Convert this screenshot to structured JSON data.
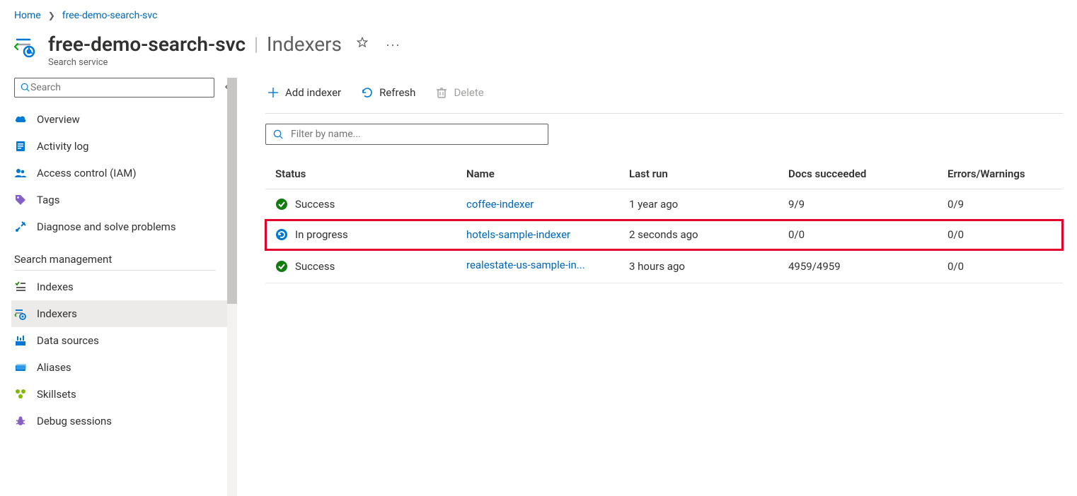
{
  "breadcrumb": {
    "home": "Home",
    "current": "free-demo-search-svc"
  },
  "header": {
    "resource_name": "free-demo-search-svc",
    "section": "Indexers",
    "subtitle": "Search service"
  },
  "sidebar": {
    "search_placeholder": "Search",
    "items": [
      {
        "label": "Overview"
      },
      {
        "label": "Activity log"
      },
      {
        "label": "Access control (IAM)"
      },
      {
        "label": "Tags"
      },
      {
        "label": "Diagnose and solve problems"
      }
    ],
    "section_title": "Search management",
    "mgmt_items": [
      {
        "label": "Indexes"
      },
      {
        "label": "Indexers"
      },
      {
        "label": "Data sources"
      },
      {
        "label": "Aliases"
      },
      {
        "label": "Skillsets"
      },
      {
        "label": "Debug sessions"
      }
    ]
  },
  "toolbar": {
    "add": "Add indexer",
    "refresh": "Refresh",
    "delete": "Delete"
  },
  "filter": {
    "placeholder": "Filter by name..."
  },
  "table": {
    "columns": {
      "status": "Status",
      "name": "Name",
      "last_run": "Last run",
      "docs": "Docs succeeded",
      "errors": "Errors/Warnings"
    },
    "rows": [
      {
        "status": "Success",
        "status_kind": "success",
        "name": "coffee-indexer",
        "last_run": "1 year ago",
        "docs": "9/9",
        "errors": "0/9"
      },
      {
        "status": "In progress",
        "status_kind": "progress",
        "name": "hotels-sample-indexer",
        "last_run": "2 seconds ago",
        "docs": "0/0",
        "errors": "0/0"
      },
      {
        "status": "Success",
        "status_kind": "success",
        "name": "realestate-us-sample-in...",
        "last_run": "3 hours ago",
        "docs": "4959/4959",
        "errors": "0/0"
      }
    ]
  }
}
